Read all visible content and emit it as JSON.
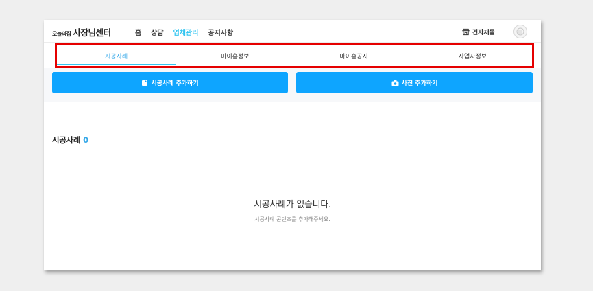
{
  "brand": {
    "small": "오늘의집",
    "big": "사장님센터"
  },
  "nav": {
    "items": [
      {
        "label": "홈",
        "active": false
      },
      {
        "label": "상담",
        "active": false
      },
      {
        "label": "업체관리",
        "active": true
      },
      {
        "label": "공지사항",
        "active": false
      }
    ]
  },
  "header_right": {
    "shop_label": "건자재몰"
  },
  "tabs": [
    {
      "label": "시공사례",
      "active": true
    },
    {
      "label": "마이홈정보",
      "active": false
    },
    {
      "label": "마이홈공지",
      "active": false
    },
    {
      "label": "사업자정보",
      "active": false
    }
  ],
  "actions": {
    "add_case_label": "시공사례 추가하기",
    "add_photo_label": "사진 추가하기"
  },
  "section": {
    "title": "시공사례",
    "count": "0"
  },
  "empty": {
    "title": "시공사례가 없습니다.",
    "subtitle": "시공사례 콘텐츠를 추가해주세요."
  },
  "colors": {
    "accent": "#35c5f0",
    "button": "#0ea5ff",
    "highlight_border": "#e50000"
  }
}
